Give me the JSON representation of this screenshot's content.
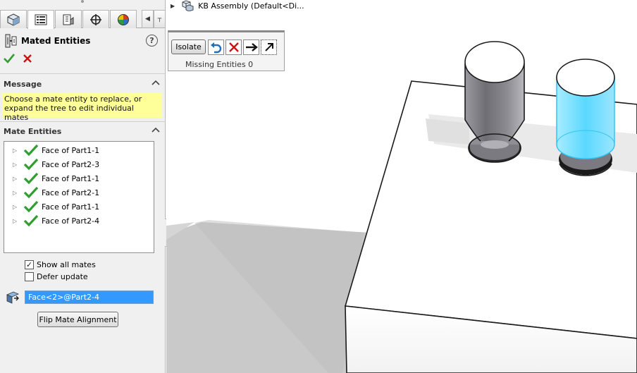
{
  "panel": {
    "tabs": [
      {
        "name": "feature-manager-tab",
        "icon": "cube-icon"
      },
      {
        "name": "property-manager-tab",
        "icon": "list-icon",
        "active": true
      },
      {
        "name": "configuration-manager-tab",
        "icon": "config-icon"
      },
      {
        "name": "dimxpert-tab",
        "icon": "crosshair-icon"
      },
      {
        "name": "display-manager-tab",
        "icon": "appearance-icon"
      }
    ],
    "title": "Mated Entities",
    "help_glyph": "?",
    "sections": {
      "message": {
        "title": "Message",
        "text": "Choose a mate entity to replace, or expand the tree to edit individual mates"
      },
      "mate_entities": {
        "title": "Mate Entities",
        "items": [
          "Face of Part1-1",
          "Face of Part2-3",
          "Face of Part1-1",
          "Face of Part2-1",
          "Face of Part1-1",
          "Face of Part2-4"
        ]
      }
    },
    "show_all_mates": {
      "label": "Show all mates",
      "checked": true
    },
    "defer_update": {
      "label": "Defer update",
      "checked": false
    },
    "replacement_entity": "Face<2>@Part2-4",
    "flip_button": "Flip Mate Alignment"
  },
  "viewport": {
    "tree_root_label": "KB Assembly  (Default<Di...",
    "toolbar": {
      "isolate_label": "Isolate",
      "missing_label": "Missing Entities 0"
    }
  },
  "colors": {
    "message_bg": "#ffff99",
    "selection": "#3399ff",
    "check_green": "#2f9e2f",
    "cancel_red": "#cc1111",
    "highlight_cyan": "#5ad8ff"
  }
}
